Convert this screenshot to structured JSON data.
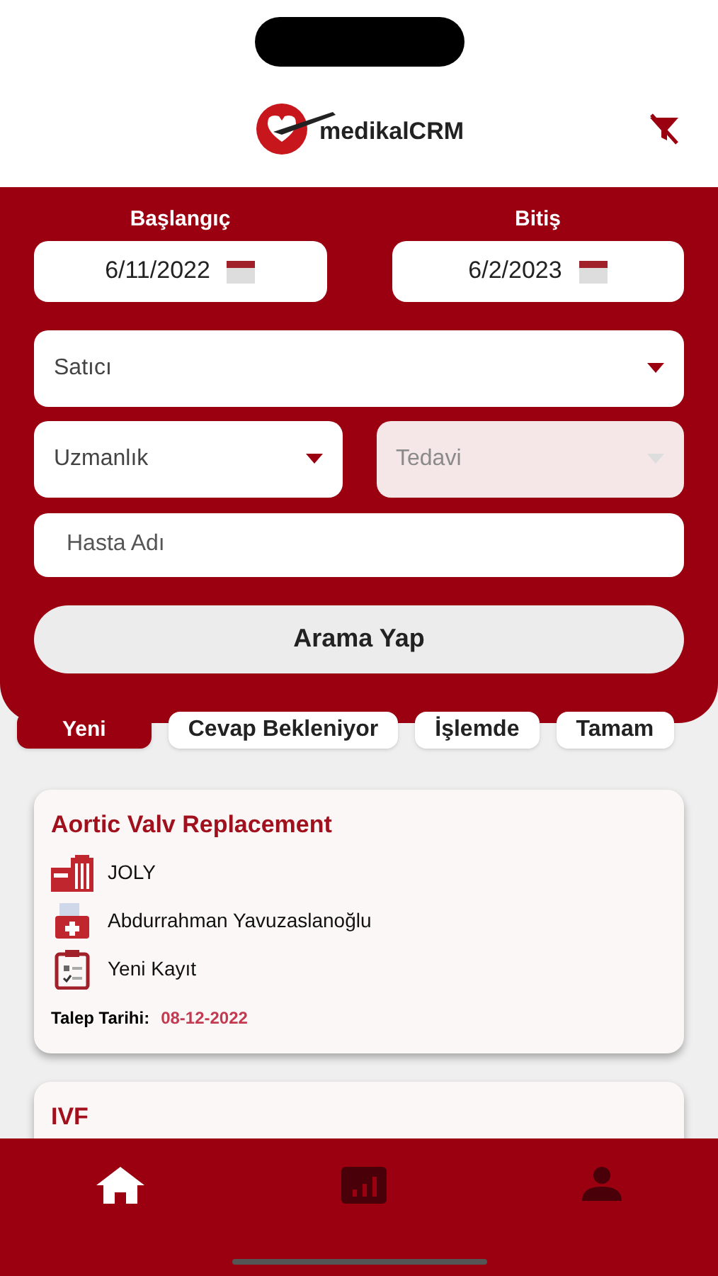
{
  "header": {
    "logo_text": "medikalCRM"
  },
  "filters": {
    "start_label": "Başlangıç",
    "start_date": "6/11/2022",
    "end_label": "Bitiş",
    "end_date": "6/2/2023",
    "seller": {
      "placeholder": "Satıcı",
      "disabled": false
    },
    "specialty": {
      "placeholder": "Uzmanlık",
      "disabled": false
    },
    "treatment": {
      "placeholder": "Tedavi",
      "disabled": true
    },
    "patient_name": {
      "placeholder": "Hasta Adı"
    },
    "search_button": "Arama Yap"
  },
  "tabs": [
    {
      "label": "Yeni",
      "selected": true
    },
    {
      "label": "Cevap Bekleniyor",
      "selected": false
    },
    {
      "label": "İşlemde",
      "selected": false
    },
    {
      "label": "Tamam",
      "selected": false
    }
  ],
  "cards": [
    {
      "title": "Aortic Valv Replacement",
      "hospital": "JOLY",
      "patient": "Abdurrahman Yavuzaslanoğlu",
      "status": "Yeni Kayıt",
      "date_label": "Talep Tarihi:",
      "date": "08-12-2022"
    },
    {
      "title": "IVF"
    }
  ],
  "bottom_nav": [
    {
      "kind": "home",
      "selected": true
    },
    {
      "kind": "chart",
      "selected": false
    },
    {
      "kind": "profile",
      "selected": false
    }
  ]
}
